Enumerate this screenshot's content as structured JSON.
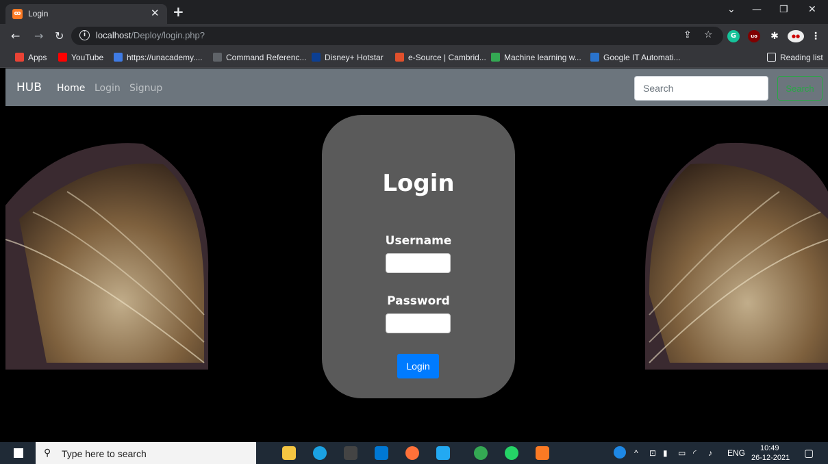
{
  "browser": {
    "tab_title": "Login",
    "tab_favicon": "xampp",
    "url_host": "localhost",
    "url_path": "/Deploy/login.php?",
    "bookmarks": [
      {
        "label": "Apps",
        "icon": "apps-grid-icon",
        "color": "#ea4335"
      },
      {
        "label": "YouTube",
        "icon": "youtube-icon",
        "color": "#ff0000"
      },
      {
        "label": "https://unacademy....",
        "icon": "unacademy-icon",
        "color": "#3f7be4"
      },
      {
        "label": "Command Referenc...",
        "icon": "document-icon",
        "color": "#5f6368"
      },
      {
        "label": "Disney+ Hotstar",
        "icon": "hotstar-icon",
        "color": "#0c3f92"
      },
      {
        "label": "e-Source | Cambrid...",
        "icon": "cambridge-icon",
        "color": "#e0502c"
      },
      {
        "label": "Machine learning w...",
        "icon": "google-drive-icon",
        "color": "#34a853"
      },
      {
        "label": "Google IT Automati...",
        "icon": "coursera-icon",
        "color": "#2a73cc"
      }
    ],
    "reading_list": "Reading list"
  },
  "navbar": {
    "brand": "HUB",
    "links": [
      {
        "label": "Home",
        "active": true
      },
      {
        "label": "Login",
        "active": false
      },
      {
        "label": "Signup",
        "active": false
      }
    ],
    "search_placeholder": "Search",
    "search_button": "Search"
  },
  "login": {
    "title": "Login",
    "username_label": "Username",
    "password_label": "Password",
    "submit_label": "Login"
  },
  "taskbar": {
    "search_placeholder": "Type here to search",
    "language": "ENG",
    "time": "10:49",
    "date": "26-12-2021"
  },
  "colors": {
    "navbar_bg": "#6c757d",
    "card_bg": "#5a5a5a",
    "primary": "#007bff",
    "success": "#28a745"
  }
}
